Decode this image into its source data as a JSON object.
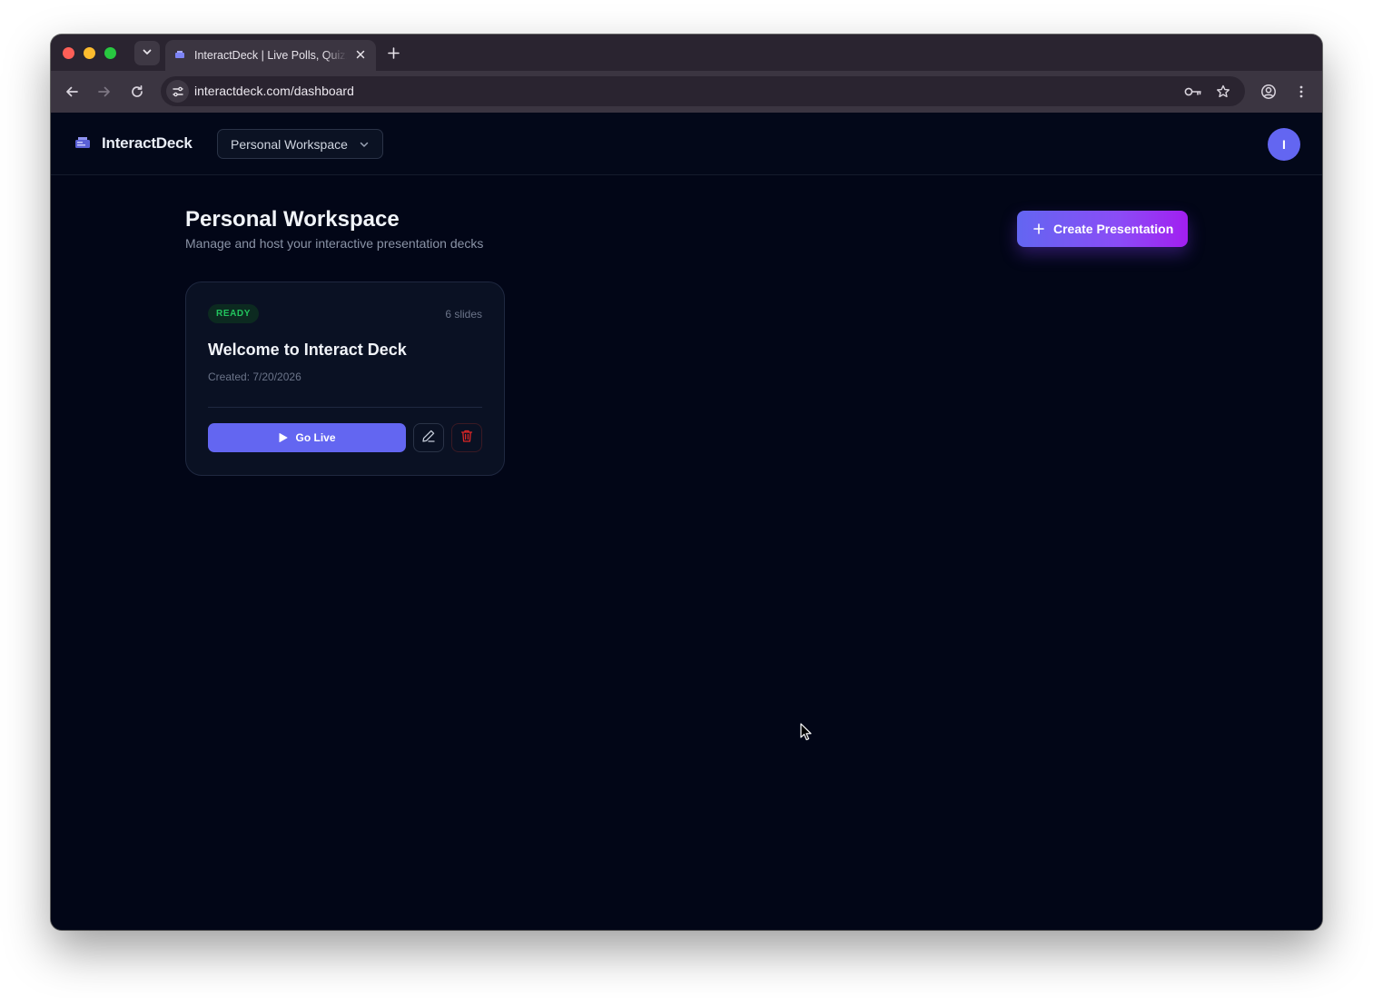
{
  "browser": {
    "tab": {
      "title": "InteractDeck | Live Polls, Quizzes"
    },
    "address_bar": {
      "url": "interactdeck.com/dashboard"
    },
    "icons": [
      "tab-search-icon",
      "close-icon",
      "new-tab-icon",
      "back-icon",
      "forward-icon",
      "reload-icon",
      "site-info-icon",
      "password-key-icon",
      "bookmark-star-icon",
      "profile-icon",
      "more-menu-icon"
    ]
  },
  "header": {
    "brand": "InteractDeck",
    "workspace_selector": "Personal Workspace",
    "avatar_initial": "I"
  },
  "main": {
    "title": "Personal Workspace",
    "subtitle": "Manage and host your interactive presentation decks",
    "create_button": "Create Presentation"
  },
  "presentations": [
    {
      "status": "READY",
      "slides": "6 slides",
      "title": "Welcome to Interact Deck",
      "created": "Created: 7/20/2026",
      "go_live_label": "Go Live"
    }
  ],
  "colors": {
    "accent": "#6366f1",
    "accent_gradient_end": "#a21ff0",
    "status_ready": "#22c55e",
    "danger": "#dc2626",
    "page_background": "#020617"
  }
}
